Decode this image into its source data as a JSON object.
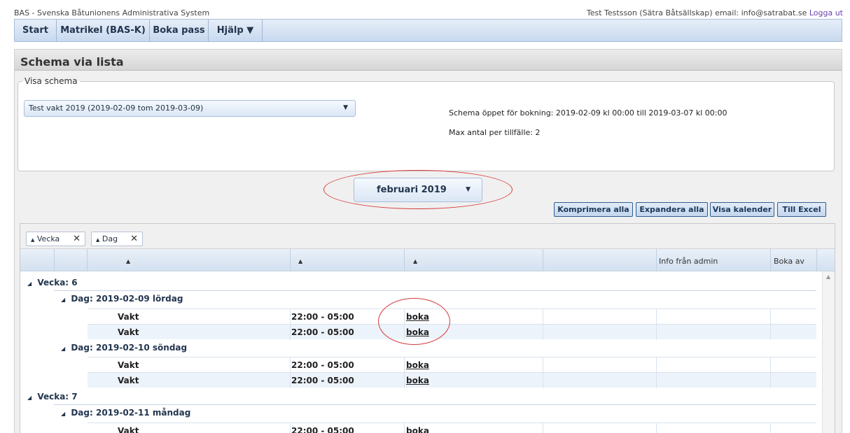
{
  "app_title": "BAS - Svenska Båtunionens Administrativa System",
  "user": {
    "name": "Test Testsson (Sätra Båtsällskap)",
    "email_label": "email:",
    "email": "info@satrabat.se",
    "logout": "Logga ut"
  },
  "nav": {
    "items": [
      {
        "label": "Start"
      },
      {
        "label": "Matrikel (BAS-K)"
      },
      {
        "label": "Boka pass"
      },
      {
        "label": "Hjälp ▼"
      }
    ]
  },
  "page_title": "Schema via lista",
  "visa_schema": {
    "legend": "Visa schema",
    "selected": "Test vakt 2019 (2019-02-09 tom 2019-03-09)",
    "open_info": "Schema öppet för bokning: 2019-02-09 kl 00:00 till 2019-03-07 kl 00:00",
    "max_info": "Max antal per tillfälle: 2"
  },
  "month": {
    "selected": "februari 2019"
  },
  "actions": {
    "compress": "Komprimera alla",
    "expand": "Expandera alla",
    "calendar": "Visa kalender",
    "excel": "Till Excel"
  },
  "grouping": {
    "chips": [
      {
        "label": "Vecka"
      },
      {
        "label": "Dag"
      }
    ]
  },
  "columns": {
    "sort_glyph": "▲",
    "info": "Info från admin",
    "boka_av": "Boka av"
  },
  "rows": {
    "week6": "Vecka: 6",
    "day1": "Dag: 2019-02-09 lördag",
    "day2": "Dag: 2019-02-10 söndag",
    "week7": "Vecka: 7",
    "day3": "Dag: 2019-02-11 måndag",
    "slot_name": "Vakt",
    "slot_time": "22:00 - 05:00",
    "slot_action": "boka"
  },
  "glyphs": {
    "expanded": "◢",
    "dropdown": "▼",
    "close": "✕",
    "scroll_up": "▲",
    "chip_sort": "▲"
  }
}
